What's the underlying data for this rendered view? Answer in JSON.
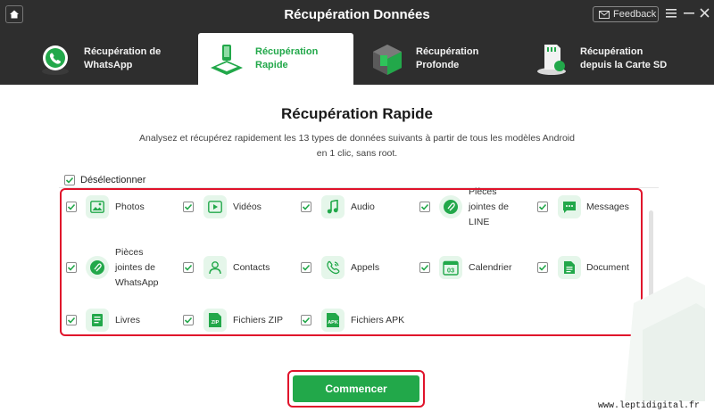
{
  "window": {
    "title": "Récupération Données",
    "feedback_label": "Feedback",
    "menu_icon": "hamburger-icon",
    "minimize_icon": "minimize-icon",
    "close_icon": "close-icon"
  },
  "tabs": [
    {
      "label": "Récupération de\nWhatsApp",
      "icon": "whatsapp-icon",
      "active": false
    },
    {
      "label": "Récupération\nRapide",
      "icon": "quick-recovery-icon",
      "active": true
    },
    {
      "label": "Récupération\nProfonde",
      "icon": "deep-recovery-icon",
      "active": false
    },
    {
      "label": "Récupération\ndepuis la Carte SD",
      "icon": "sd-card-icon",
      "active": false
    }
  ],
  "main": {
    "title": "Récupération Rapide",
    "description": "Analysez et récupérez rapidement les 13 types de données suivants à partir de tous les modèles Android\nen 1 clic, sans root.",
    "select_all_label": "Désélectionner"
  },
  "items": [
    {
      "label": "Photos",
      "icon": "photo-icon",
      "checked": true
    },
    {
      "label": "Vidéos",
      "icon": "video-icon",
      "checked": true
    },
    {
      "label": "Audio",
      "icon": "music-icon",
      "checked": true
    },
    {
      "label": "Pièces\njointes de\nLINE",
      "icon": "line-icon",
      "checked": true
    },
    {
      "label": "Messages",
      "icon": "message-icon",
      "checked": true
    },
    {
      "label": "Pièces\njointes de\nWhatsApp",
      "icon": "whatsapp-attachment-icon",
      "checked": true
    },
    {
      "label": "Contacts",
      "icon": "contact-icon",
      "checked": true
    },
    {
      "label": "Appels",
      "icon": "phone-icon",
      "checked": true
    },
    {
      "label": "Calendrier",
      "icon": "calendar-icon",
      "checked": true
    },
    {
      "label": "Document",
      "icon": "document-icon",
      "checked": true
    },
    {
      "label": "Livres",
      "icon": "book-icon",
      "checked": true
    },
    {
      "label": "Fichiers ZIP",
      "icon": "zip-icon",
      "checked": true
    },
    {
      "label": "Fichiers APK",
      "icon": "apk-icon",
      "checked": true
    }
  ],
  "icon_text": {
    "calendar": "03",
    "zip": "ZIP",
    "apk": "APK"
  },
  "action": {
    "start_label": "Commencer"
  },
  "watermark": "www.leptidigital.fr",
  "colors": {
    "accent": "#22a84a",
    "titlebar": "#2e2e2e",
    "highlight": "#e0132b"
  }
}
